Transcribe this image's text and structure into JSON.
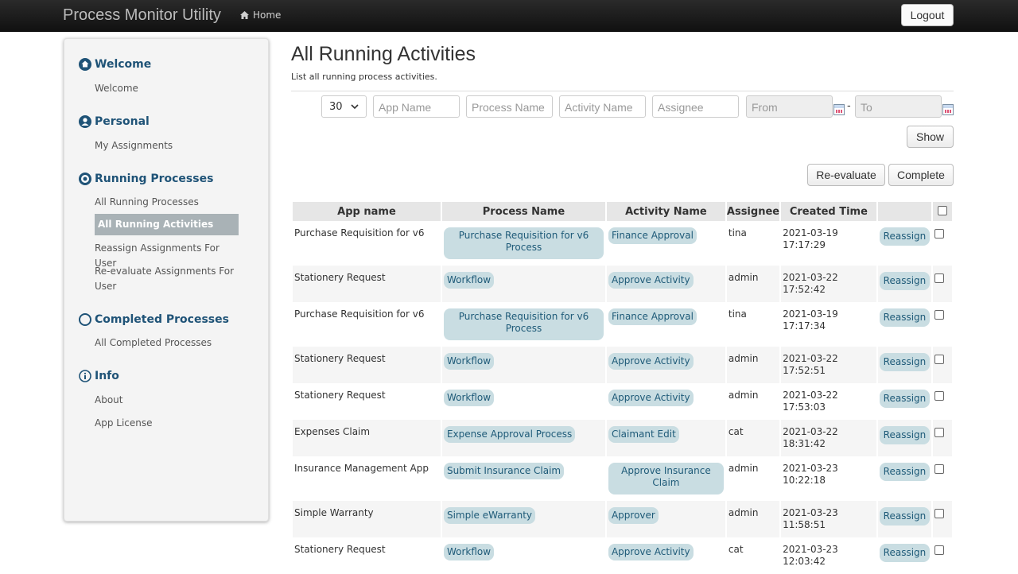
{
  "app": {
    "title": "Process Monitor Utility",
    "home_label": "Home",
    "logout_label": "Logout"
  },
  "sidebar": {
    "sections": [
      {
        "title": "Welcome",
        "icon": "home-circle-icon",
        "items": [
          "Welcome"
        ]
      },
      {
        "title": "Personal",
        "icon": "user-circle-icon",
        "items": [
          "My Assignments"
        ]
      },
      {
        "title": "Running Processes",
        "icon": "target-circle-icon",
        "items": [
          "All Running Processes",
          "All Running Activities",
          "Reassign Assignments For User",
          "Re-evaluate Assignments For User"
        ]
      },
      {
        "title": "Completed Processes",
        "icon": "empty-circle-icon",
        "items": [
          "All Completed Processes"
        ]
      },
      {
        "title": "Info",
        "icon": "info-circle-icon",
        "items": [
          "About",
          "App License"
        ]
      }
    ],
    "active_item": "All Running Activities"
  },
  "page": {
    "title": "All Running Activities",
    "description": "List all running process activities."
  },
  "filters": {
    "rows_value": "30",
    "app_name_placeholder": "App Name",
    "process_name_placeholder": "Process Name",
    "activity_name_placeholder": "Activity Name",
    "assignee_placeholder": "Assignee",
    "from_placeholder": "From",
    "to_placeholder": "To",
    "range_separator": "-",
    "show_label": "Show"
  },
  "actions": {
    "reevaluate_label": "Re-evaluate",
    "complete_label": "Complete"
  },
  "table": {
    "headers": [
      "App name",
      "Process Name",
      "Activity Name",
      "Assignee",
      "Created Time"
    ],
    "reassign_label": "Reassign",
    "rows": [
      {
        "app": "Purchase Requisition for v6",
        "process": "Purchase Requisition for v6 Process",
        "activity": "Finance Approval",
        "assignee": "tina",
        "date": "2021-03-19",
        "time": "17:17:29"
      },
      {
        "app": "Stationery Request",
        "process": "Workflow",
        "activity": "Approve Activity",
        "assignee": "admin",
        "date": "2021-03-22",
        "time": "17:52:42"
      },
      {
        "app": "Purchase Requisition for v6",
        "process": "Purchase Requisition for v6 Process",
        "activity": "Finance Approval",
        "assignee": "tina",
        "date": "2021-03-19",
        "time": "17:17:34"
      },
      {
        "app": "Stationery Request",
        "process": "Workflow",
        "activity": "Approve Activity",
        "assignee": "admin",
        "date": "2021-03-22",
        "time": "17:52:51"
      },
      {
        "app": "Stationery Request",
        "process": "Workflow",
        "activity": "Approve Activity",
        "assignee": "admin",
        "date": "2021-03-22",
        "time": "17:53:03"
      },
      {
        "app": "Expenses Claim",
        "process": "Expense Approval Process",
        "activity": "Claimant Edit",
        "assignee": "cat",
        "date": "2021-03-22",
        "time": "18:31:42"
      },
      {
        "app": "Insurance Management App",
        "process": "Submit Insurance Claim",
        "activity": "Approve Insurance Claim",
        "assignee": "admin",
        "date": "2021-03-23",
        "time": "10:22:18"
      },
      {
        "app": "Simple Warranty",
        "process": "Simple eWarranty",
        "activity": "Approver",
        "assignee": "admin",
        "date": "2021-03-23",
        "time": "11:58:51"
      },
      {
        "app": "Stationery Request",
        "process": "Workflow",
        "activity": "Approve Activity",
        "assignee": "cat",
        "date": "2021-03-23",
        "time": "12:03:42"
      }
    ]
  }
}
